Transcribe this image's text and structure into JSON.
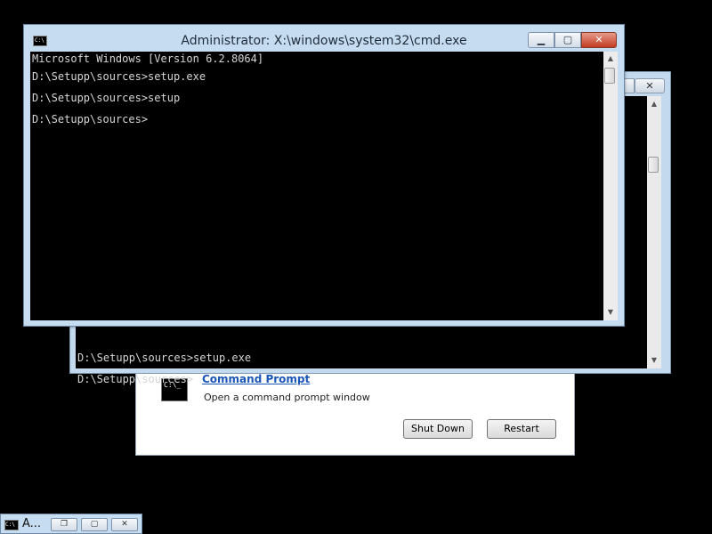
{
  "recovery": {
    "item_title": "Command Prompt",
    "item_desc": "Open a command prompt window",
    "icon_text": "C:\\_",
    "shutdown_label": "Shut Down",
    "restart_label": "Restart"
  },
  "back_window": {
    "close_glyph": "✕",
    "lines": [
      "D:\\Setupp\\sources>setup.exe",
      "D:\\Setupp\\sources>"
    ]
  },
  "front_window": {
    "title": "Administrator: X:\\windows\\system32\\cmd.exe",
    "icon_text": "C:\\",
    "min_glyph": "▁",
    "max_glyph": "▢",
    "close_glyph": "✕",
    "lines": [
      "Microsoft Windows [Version 6.2.8064]",
      "",
      "D:\\Setupp\\sources>setup.exe",
      "D:\\Setupp\\sources>setup",
      "D:\\Setupp\\sources>"
    ]
  },
  "taskbar": {
    "label": "A...",
    "icon_text": "C:\\",
    "restore_glyph": "❐",
    "max_glyph": "▢",
    "close_glyph": "✕"
  }
}
